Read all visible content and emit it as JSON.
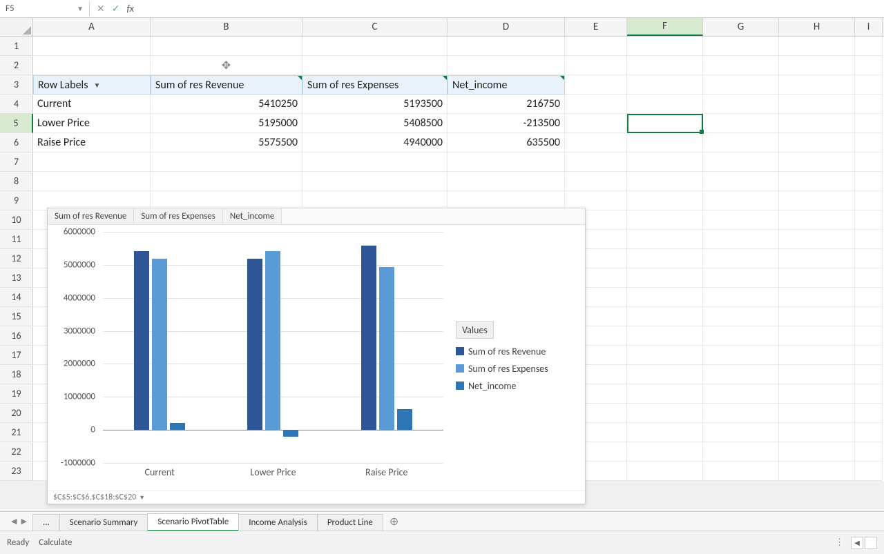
{
  "formula_bar": {
    "name_box": "F5",
    "fx": "fx",
    "value": ""
  },
  "columns": [
    "A",
    "B",
    "C",
    "D",
    "E",
    "F",
    "G",
    "H",
    "I"
  ],
  "row_numbers": [
    "1",
    "2",
    "3",
    "4",
    "5",
    "6",
    "7",
    "8",
    "9",
    "10",
    "11",
    "12",
    "13",
    "14",
    "15",
    "16",
    "17",
    "18",
    "19",
    "20",
    "21",
    "22",
    "23"
  ],
  "pivot": {
    "row_labels_header": "Row Labels",
    "col_headers": [
      "Sum of res Revenue",
      "Sum of res Expenses",
      "Net_income"
    ],
    "rows": [
      {
        "label": "Current",
        "rev": "5410250",
        "exp": "5193500",
        "net": "216750"
      },
      {
        "label": "Lower Price",
        "rev": "5195000",
        "exp": "5408500",
        "net": "-213500"
      },
      {
        "label": "Raise Price",
        "rev": "5575500",
        "exp": "4940000",
        "net": "635500"
      }
    ]
  },
  "chart_data": {
    "type": "bar",
    "buttons": [
      "Sum of res Revenue",
      "Sum of res Expenses",
      "Net_income"
    ],
    "categories": [
      "Current",
      "Lower Price",
      "Raise Price"
    ],
    "series": [
      {
        "name": "Sum of res Revenue",
        "color": "#2f5597",
        "values": [
          5410250,
          5195000,
          5575500
        ]
      },
      {
        "name": "Sum of res Expenses",
        "color": "#5b9bd5",
        "values": [
          5193500,
          5408500,
          4940000
        ]
      },
      {
        "name": "Net_income",
        "color": "#2e75b6",
        "values": [
          216750,
          -213500,
          635500
        ]
      }
    ],
    "y_ticks": [
      "6000000",
      "5000000",
      "4000000",
      "3000000",
      "2000000",
      "1000000",
      "0",
      "-1000000"
    ],
    "ylim": [
      -1000000,
      6000000
    ],
    "legend_title": "Values",
    "filter_text": "$C$5:$C$6,$C$18:$C$20"
  },
  "sheet_tabs": {
    "items": [
      "...",
      "Scenario Summary",
      "Scenario PivotTable",
      "Income Analysis",
      "Product Line"
    ],
    "active": "Scenario PivotTable"
  },
  "status": {
    "ready": "Ready",
    "calculate": "Calculate"
  },
  "colors": {
    "series1": "#2f5597",
    "series2": "#5b9bd5",
    "series3": "#2e75b6"
  }
}
